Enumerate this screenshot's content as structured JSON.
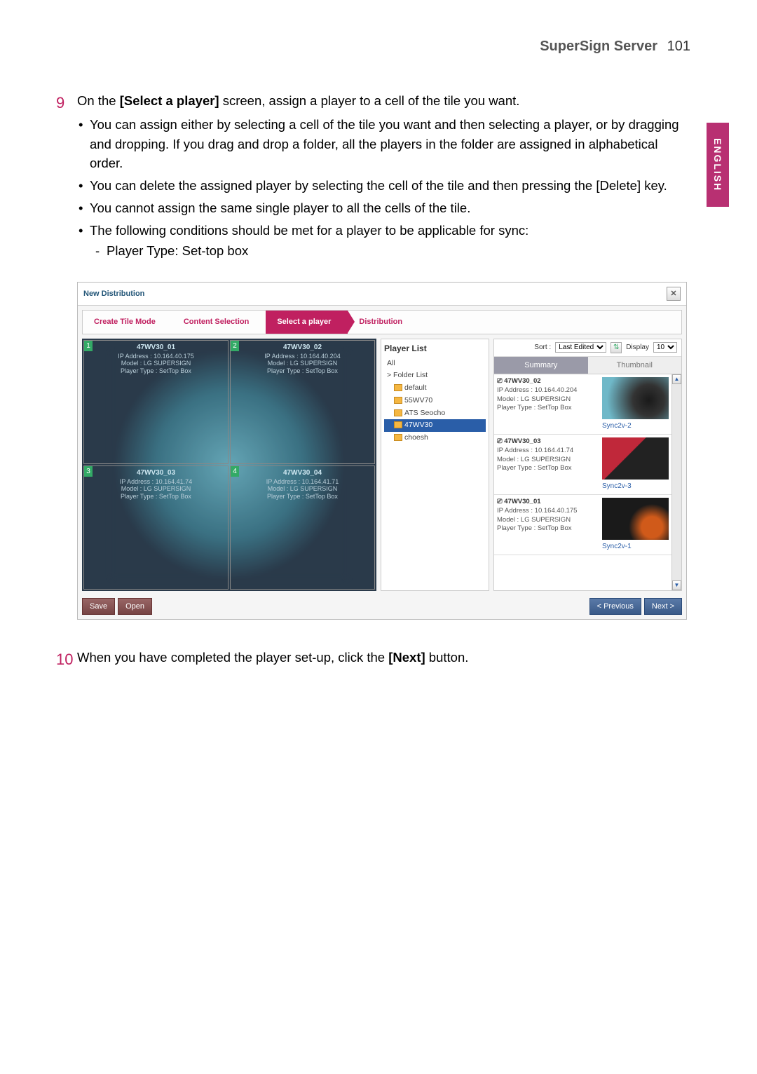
{
  "header": {
    "title": "SuperSign Server",
    "page_number": "101"
  },
  "side_tab": "ENGLISH",
  "step9": {
    "num": "9",
    "lead_before": "On the ",
    "lead_bold": "[Select a player]",
    "lead_after": " screen, assign a player to a cell of the tile you want.",
    "bul1": "You can assign either by selecting a cell of the tile you want and then selecting a player, or by dragging and dropping. If you drag and drop a folder, all the players in the folder are assigned in alphabetical order.",
    "bul2": "You can delete the assigned player by selecting the cell of the tile and then pressing the [Delete] key.",
    "bul3": "You cannot assign the same single player to all the cells of the tile.",
    "bul4": "The following conditions should be met for a player to be applicable for sync:",
    "sub1": "Player Type: Set-top box"
  },
  "step10": {
    "num": "10",
    "lead_before": "When you have completed the player set-up, click the ",
    "lead_bold": "[Next]",
    "lead_after": " button."
  },
  "shot": {
    "title": "New Distribution",
    "close": "✕",
    "wizard": [
      "Create Tile Mode",
      "Content Selection",
      "Select a player",
      "Distribution"
    ],
    "tile_common": {
      "model": "Model : LG SUPERSIGN",
      "ptype": "Player Type : SetTop Box"
    },
    "tiles": [
      {
        "n": "1",
        "name": "47WV30_01",
        "ip": "IP Address : 10.164.40.175"
      },
      {
        "n": "2",
        "name": "47WV30_02",
        "ip": "IP Address : 10.164.40.204"
      },
      {
        "n": "3",
        "name": "47WV30_03",
        "ip": "IP Address : 10.164.41.74"
      },
      {
        "n": "4",
        "name": "47WV30_04",
        "ip": "IP Address : 10.164.41.71"
      }
    ],
    "plist": {
      "title": "Player List",
      "all": "All",
      "folder": "> Folder List",
      "items": [
        "default",
        "55WV70",
        "ATS Seocho",
        "47WV30",
        "choesh"
      ],
      "selected_index": 3
    },
    "rp": {
      "sort_label": "Sort :",
      "sort_value": "Last Edited",
      "display_label": "Display",
      "display_value": "10",
      "tabs": [
        "Summary",
        "Thumbnail"
      ],
      "rows": [
        {
          "name": "47WV30_02",
          "ip": "IP Address : 10.164.40.204",
          "cap": "Sync2v-2",
          "imgclass": "b"
        },
        {
          "name": "47WV30_03",
          "ip": "IP Address : 10.164.41.74",
          "cap": "Sync2v-3",
          "imgclass": "c"
        },
        {
          "name": "47WV30_01",
          "ip": "IP Address : 10.164.40.175",
          "cap": "Sync2v-1",
          "imgclass": "d"
        }
      ],
      "common": {
        "model": "Model : LG SUPERSIGN",
        "ptype": "Player Type : SetTop Box"
      }
    },
    "footer": {
      "save": "Save",
      "open": "Open",
      "prev": "< Previous",
      "next": "Next >"
    }
  }
}
